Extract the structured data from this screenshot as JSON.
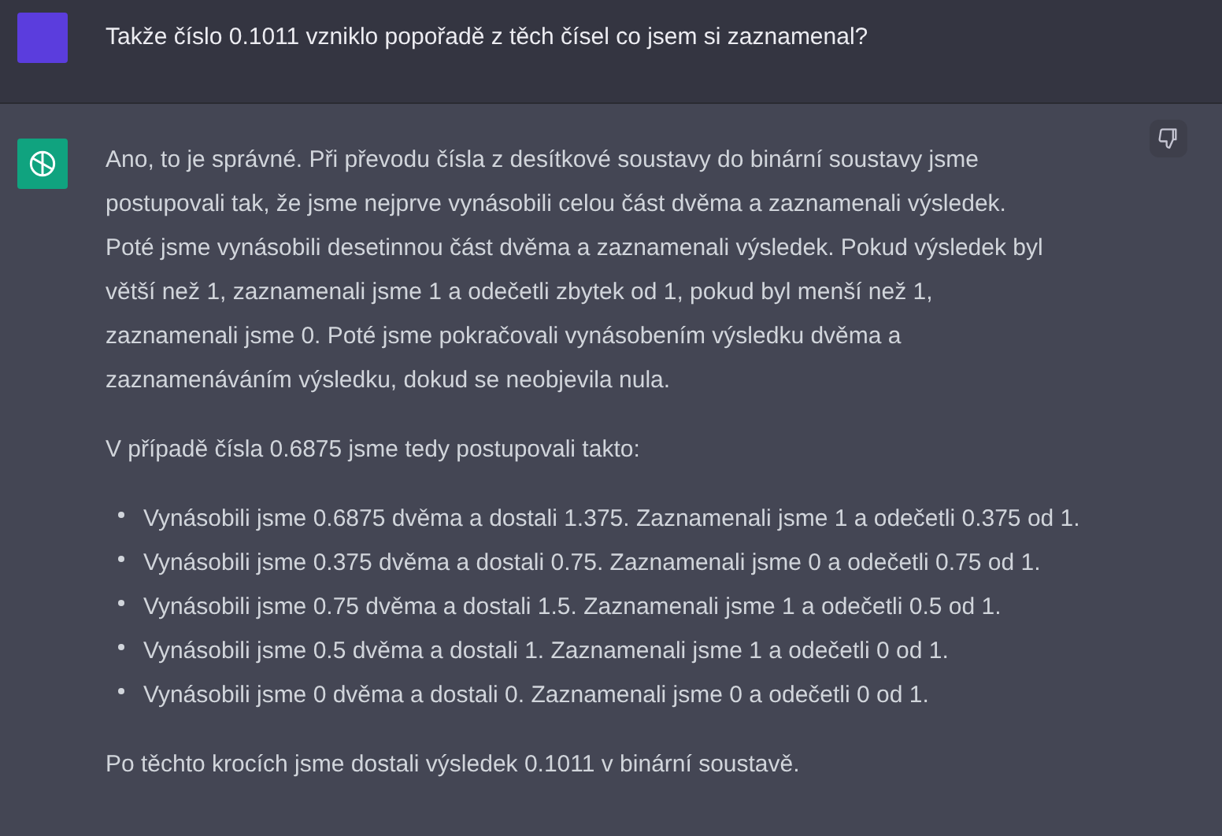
{
  "user_message": {
    "text": "Takže číslo 0.1011 vzniklo popořadě z těch čísel co jsem si zaznamenal?"
  },
  "assistant_message": {
    "paragraphs": [
      "Ano, to je správné. Při převodu čísla z desítkové soustavy do binární soustavy jsme postupovali tak, že jsme nejprve vynásobili celou část dvěma a zaznamenali výsledek. Poté jsme vynásobili desetinnou část dvěma a zaznamenali výsledek. Pokud výsledek byl větší než 1, zaznamenali jsme 1 a odečetli zbytek od 1, pokud byl menší než 1, zaznamenali jsme 0. Poté jsme pokračovali vynásobením výsledku dvěma a zaznamenáváním výsledku, dokud se neobjevila nula.",
      "V případě čísla 0.6875 jsme tedy postupovali takto:"
    ],
    "list": [
      "Vynásobili jsme 0.6875 dvěma a dostali 1.375. Zaznamenali jsme 1 a odečetli 0.375 od 1.",
      "Vynásobili jsme 0.375 dvěma a dostali 0.75. Zaznamenali jsme 0 a odečetli 0.75 od 1.",
      "Vynásobili jsme 0.75 dvěma a dostali 1.5. Zaznamenali jsme 1 a odečetli 0.5 od 1.",
      "Vynásobili jsme 0.5 dvěma a dostali 1. Zaznamenali jsme 1 a odečetli 0 od 1.",
      "Vynásobili jsme 0 dvěma a dostali 0. Zaznamenali jsme 0 a odečetli 0 od 1."
    ],
    "closing": "Po těchto krocích jsme dostali výsledek 0.1011 v binární soustavě."
  }
}
